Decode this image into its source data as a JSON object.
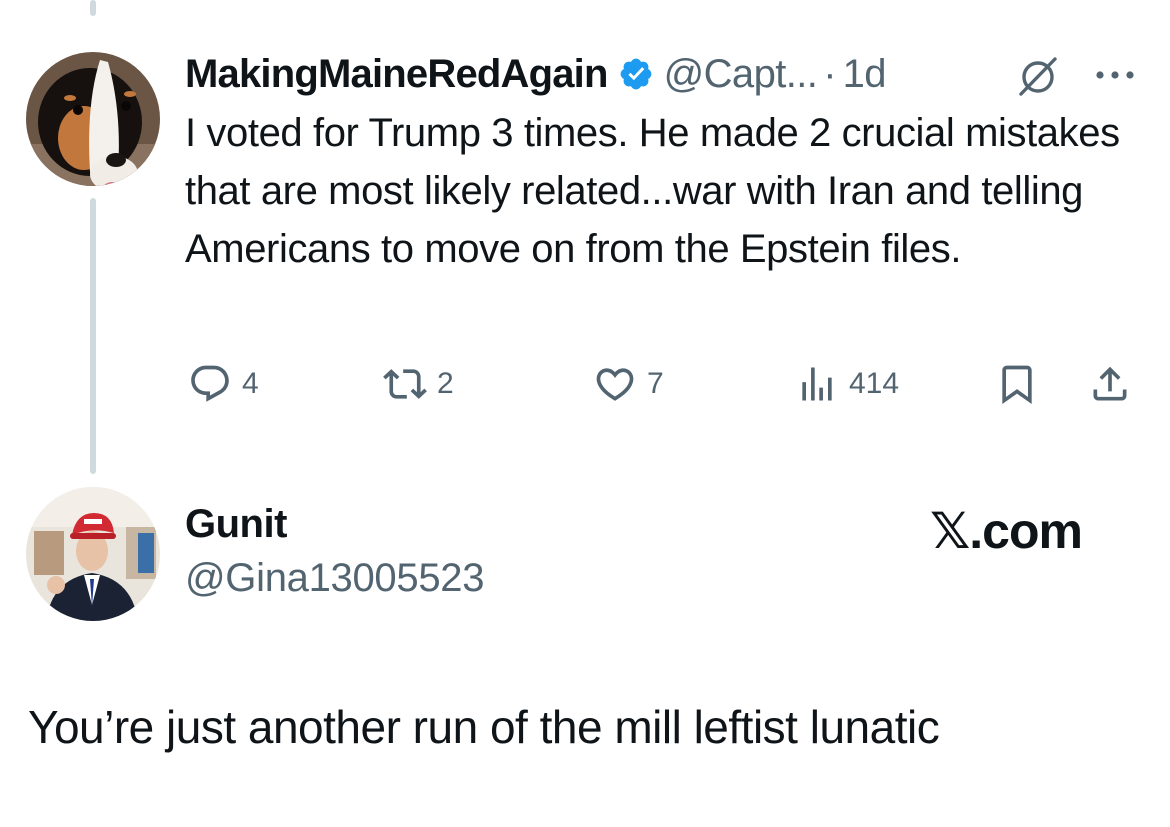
{
  "original_post": {
    "display_name": "MakingMaineRedAgain",
    "verified_icon": "verified-badge-icon",
    "handle": "@Capt...",
    "separator": "·",
    "time": "1d",
    "text": "I voted for Trump 3 times. He made 2 crucial mistakes that are most likely related...war with Iran and telling Americans to move on from the Epstein files.",
    "actions": {
      "replies": "4",
      "reposts": "2",
      "likes": "7",
      "views": "414"
    }
  },
  "reply_post": {
    "display_name": "Gunit",
    "handle": "@Gina13005523",
    "brand": "𝕏.com",
    "text": "You’re just another run of the mill leftist lunatic"
  },
  "colors": {
    "text": "#0f1419",
    "secondary": "#536471",
    "verified": "#1d9bf0",
    "thread_line": "#cfd9de"
  }
}
